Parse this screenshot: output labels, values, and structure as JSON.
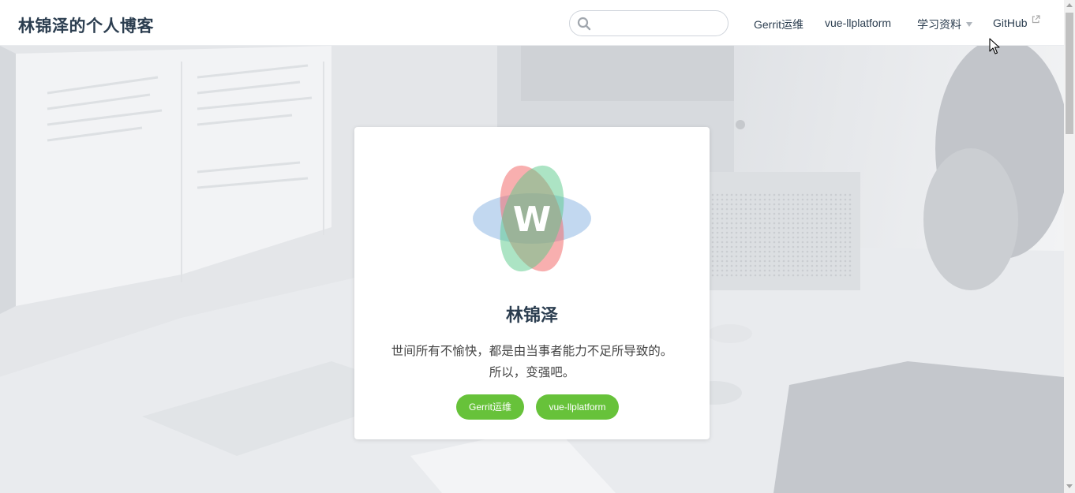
{
  "header": {
    "site_title": "林锦泽的个人博客",
    "search": {
      "placeholder": "",
      "value": ""
    },
    "nav": [
      {
        "label": "Gerrit运维"
      },
      {
        "label": "vue-llplatform"
      },
      {
        "label": "学习资料",
        "has_dropdown": true
      },
      {
        "label": "GitHub",
        "external": true
      }
    ]
  },
  "card": {
    "logo_letter": "W",
    "name": "林锦泽",
    "motto_line1": "世间所有不愉快，都是由当事者能力不足所导致的。",
    "motto_line2": "所以，变强吧。",
    "buttons": [
      {
        "label": "Gerrit运维"
      },
      {
        "label": "vue-llplatform"
      }
    ]
  },
  "colors": {
    "accent_green": "#67c23a",
    "title_text": "#2c3e50"
  }
}
